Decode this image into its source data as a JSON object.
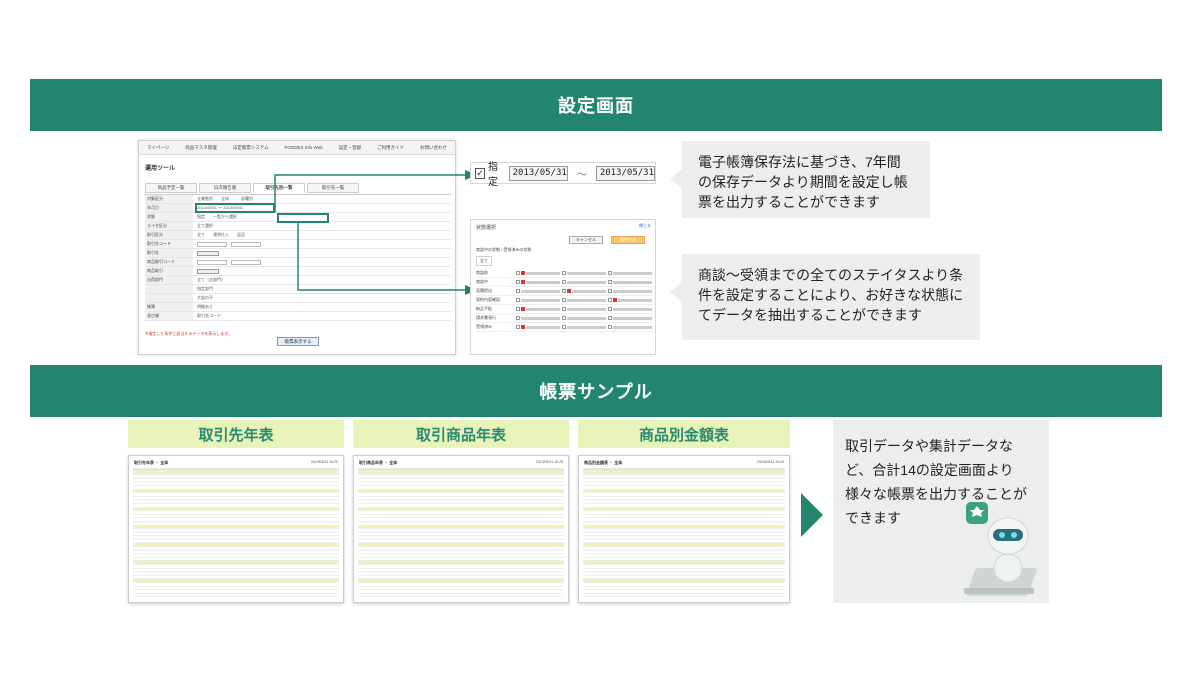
{
  "banners": {
    "settings": "設定画面",
    "samples": "帳票サンプル"
  },
  "settings_shot": {
    "nav": [
      "マイページ",
      "商品マスタ管理",
      "法定帳票システム",
      "FOODEX Info Web",
      "設定・登録",
      "ご利用ガイド",
      "お問い合わせ"
    ],
    "title": "運用ツール",
    "tabs": [
      "商品予定一覧",
      "日次報告書",
      "取引先別一覧",
      "取引先一覧"
    ],
    "rows": [
      {
        "label": "対象区分",
        "value": "全業態別　　全体　　　部署別"
      },
      {
        "label": "年月日",
        "value": "2013/05/31 〜 2013/05/31"
      },
      {
        "label": "状態",
        "value": "指定　　一覧から選択"
      },
      {
        "label": "ライセ区分",
        "value": "全て選択"
      },
      {
        "label": "取引区分",
        "value": "全て　　通常仕入　　返品"
      },
      {
        "label": "取引先コード",
        "value": ""
      },
      {
        "label": "取引先",
        "value": ""
      },
      {
        "label": "商品取引コード",
        "value": ""
      },
      {
        "label": "商品取引",
        "value": ""
      },
      {
        "label": "出荷部門",
        "value": "全て（全部門）"
      },
      {
        "label": "",
        "value": "指定部門"
      },
      {
        "label": "",
        "value": "大部の不"
      },
      {
        "label": "帳簿",
        "value": "明細あり"
      },
      {
        "label": "並び順",
        "value": "取引先コード"
      }
    ],
    "submit_label": "帳票表示する",
    "footnote": "※指定した条件に該当するデータを表示します。"
  },
  "date_zoom": {
    "checkbox_label": "指定",
    "from_date": "2013/05/31",
    "separator": "〜",
    "to_date": "2013/05/31"
  },
  "status_zoom": {
    "title": "状態選択",
    "close_label": "閉じる",
    "cancel_label": "キャンセル",
    "ok_label": "選択する",
    "legend": "商談中の状態 / 受領済みの状態",
    "all_label": "全て",
    "groups": [
      "商談前",
      "商談中",
      "見積提出",
      "契約内容確認",
      "納品手配",
      "請求書発行",
      "受領済み"
    ]
  },
  "callouts": {
    "date": "電子帳簿保存法に基づき、7年間の保存データより期間を設定し帳票を出力することができます",
    "status": "商談〜受領までの全てのステイタスより条件を設定することにより、お好きな状態にてデータを抽出することができます",
    "summary": "取引データや集計データなど、合計14の設定画面より様々な帳票を出力することができます"
  },
  "reports": [
    {
      "label": "取引先年表",
      "sheet_title": "取引先年表 ・ 全体",
      "date": "2013/05/31 15:25"
    },
    {
      "label": "取引商品年表",
      "sheet_title": "取引商品年表 ・ 全体",
      "date": "2013/05/31 15:25"
    },
    {
      "label": "商品別金額表",
      "sheet_title": "商品別金額表 ・ 全体",
      "date": "2013/05/31 15:25"
    }
  ],
  "colors": {
    "brand_green": "#24856f",
    "label_yellow": "#e8f3b9",
    "callout_gray": "#eceeed"
  }
}
